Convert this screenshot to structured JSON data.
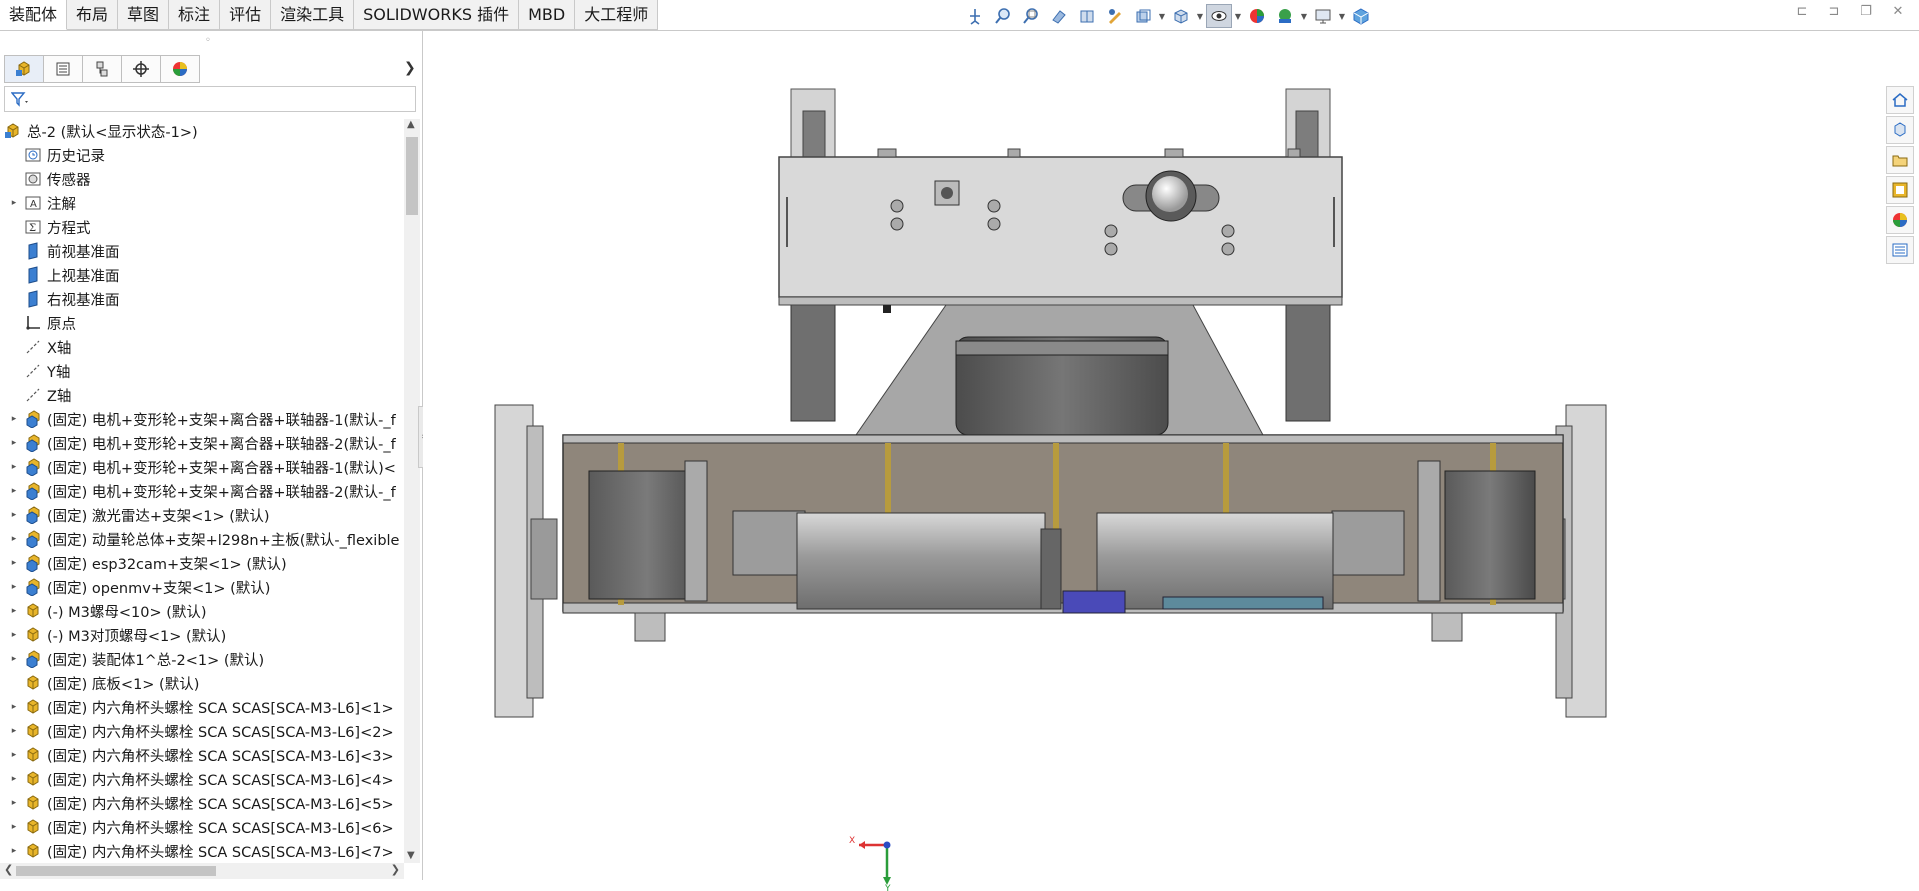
{
  "command_manager": {
    "tabs": [
      "装配体",
      "布局",
      "草图",
      "标注",
      "评估",
      "渲染工具",
      "SOLIDWORKS 插件",
      "MBD",
      "大工程师"
    ],
    "active_tab": "装配体"
  },
  "heads_up_toolbar": {
    "icons": [
      "view-orientation-icon",
      "zoom-to-fit-icon",
      "zoom-area-icon",
      "previous-view-icon",
      "section-view-icon",
      "dynamic-annotation-icon",
      "view-settings-icon",
      "display-style-icon",
      "hide-show-items-icon",
      "edit-appearance-icon",
      "apply-scene-icon",
      "view-settings-monitor-icon",
      "3d-view-icon"
    ]
  },
  "window_controls": [
    "tile-left-icon",
    "tile-right-icon",
    "restore-icon",
    "close-icon"
  ],
  "feature_manager": {
    "panel_tabs": [
      "featuremanager-tab",
      "propertymanager-tab",
      "configurationmanager-tab",
      "dimxpertmanager-tab",
      "displaymanager-tab"
    ],
    "tree": [
      {
        "label": "总-2  (默认<显示状态-1>)",
        "icon": "assembly-icon",
        "expand": "",
        "level": "root"
      },
      {
        "label": "历史记录",
        "icon": "history-icon",
        "expand": ""
      },
      {
        "label": "传感器",
        "icon": "sensor-icon",
        "expand": ""
      },
      {
        "label": "注解",
        "icon": "annotation-icon",
        "expand": "▸"
      },
      {
        "label": "方程式",
        "icon": "equation-icon",
        "expand": ""
      },
      {
        "label": "前视基准面",
        "icon": "plane-icon",
        "expand": ""
      },
      {
        "label": "上视基准面",
        "icon": "plane-icon",
        "expand": ""
      },
      {
        "label": "右视基准面",
        "icon": "plane-icon",
        "expand": ""
      },
      {
        "label": "原点",
        "icon": "origin-icon",
        "expand": ""
      },
      {
        "label": "X轴",
        "icon": "axis-icon",
        "expand": ""
      },
      {
        "label": "Y轴",
        "icon": "axis-icon",
        "expand": ""
      },
      {
        "label": "Z轴",
        "icon": "axis-icon",
        "expand": ""
      },
      {
        "label": "(固定) 电机+变形轮+支架+离合器+联轴器-1(默认-_f",
        "icon": "subassembly-icon",
        "expand": "▸"
      },
      {
        "label": "(固定) 电机+变形轮+支架+离合器+联轴器-2(默认-_f",
        "icon": "subassembly-icon",
        "expand": "▸"
      },
      {
        "label": "(固定) 电机+变形轮+支架+离合器+联轴器-1(默认)<",
        "icon": "subassembly-icon",
        "expand": "▸"
      },
      {
        "label": "(固定) 电机+变形轮+支架+离合器+联轴器-2(默认-_f",
        "icon": "subassembly-icon",
        "expand": "▸"
      },
      {
        "label": "(固定) 激光雷达+支架<1> (默认)",
        "icon": "subassembly-icon",
        "expand": "▸"
      },
      {
        "label": "(固定) 动量轮总体+支架+l298n+主板(默认-_flexible",
        "icon": "subassembly-icon",
        "expand": "▸"
      },
      {
        "label": "(固定) esp32cam+支架<1> (默认)",
        "icon": "subassembly-icon",
        "expand": "▸"
      },
      {
        "label": "(固定) openmv+支架<1> (默认)",
        "icon": "subassembly-icon",
        "expand": "▸"
      },
      {
        "label": "(-) M3螺母<10> (默认)",
        "icon": "part-icon",
        "expand": "▸"
      },
      {
        "label": "(-) M3对顶螺母<1> (默认)",
        "icon": "part-icon",
        "expand": "▸"
      },
      {
        "label": "(固定) 装配体1^总-2<1> (默认)",
        "icon": "subassembly-icon",
        "expand": "▸"
      },
      {
        "label": "(固定) 底板<1> (默认)",
        "icon": "part-icon",
        "expand": ""
      },
      {
        "label": "(固定) 内六角杯头螺栓 SCA SCAS[SCA-M3-L6]<1>",
        "icon": "part-icon",
        "expand": "▸"
      },
      {
        "label": "(固定) 内六角杯头螺栓 SCA SCAS[SCA-M3-L6]<2>",
        "icon": "part-icon",
        "expand": "▸"
      },
      {
        "label": "(固定) 内六角杯头螺栓 SCA SCAS[SCA-M3-L6]<3>",
        "icon": "part-icon",
        "expand": "▸"
      },
      {
        "label": "(固定) 内六角杯头螺栓 SCA SCAS[SCA-M3-L6]<4>",
        "icon": "part-icon",
        "expand": "▸"
      },
      {
        "label": "(固定) 内六角杯头螺栓 SCA SCAS[SCA-M3-L6]<5>",
        "icon": "part-icon",
        "expand": "▸"
      },
      {
        "label": "(固定) 内六角杯头螺栓 SCA SCAS[SCA-M3-L6]<6>",
        "icon": "part-icon",
        "expand": "▸"
      },
      {
        "label": "(固定) 内六角杯头螺栓 SCA SCAS[SCA-M3-L6]<7>",
        "icon": "part-icon",
        "expand": "▸"
      }
    ]
  },
  "triad": {
    "x_label": "X",
    "y_label": "Y"
  },
  "task_pane": {
    "icons": [
      "solidworks-resources-icon",
      "design-library-icon",
      "file-explorer-icon",
      "view-palette-icon",
      "appearances-icon",
      "custom-properties-icon"
    ]
  },
  "colors": {
    "accent": "#2b6cc4",
    "assembly_yellow": "#e8b52a",
    "plane_blue": "#3b7fd1",
    "model_gray": "#b8b8b8",
    "model_dark": "#555555"
  }
}
